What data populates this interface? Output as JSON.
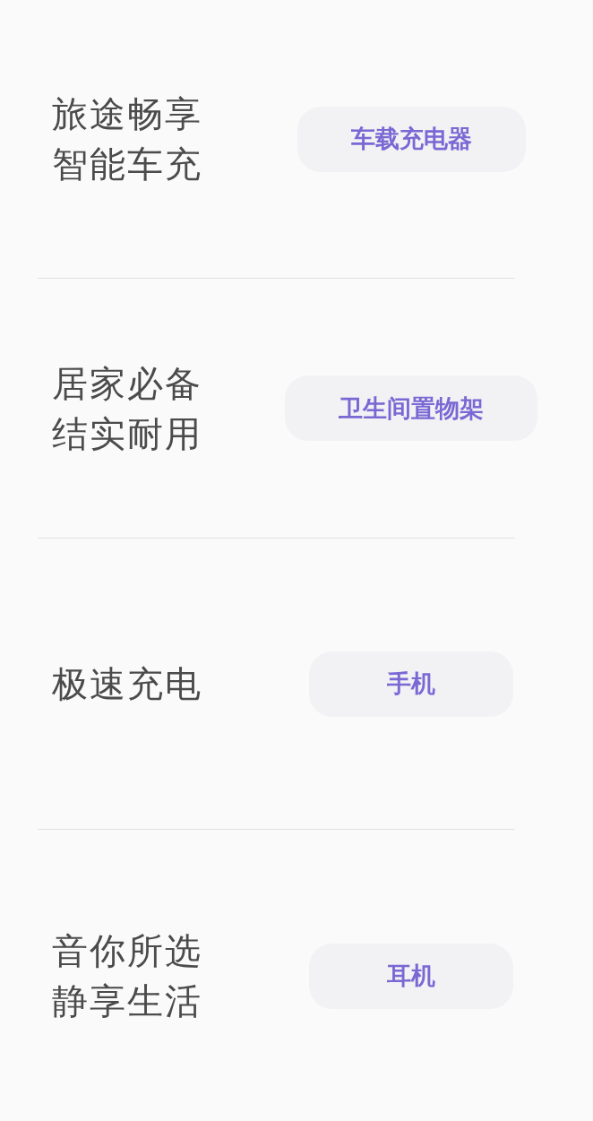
{
  "rows": [
    {
      "slogan": [
        "旅途畅享",
        "智能车充"
      ],
      "button": "车载充电器"
    },
    {
      "slogan": [
        "居家必备",
        "结实耐用"
      ],
      "button": "卫生间置物架"
    },
    {
      "slogan": [
        "极速充电"
      ],
      "button": "手机"
    },
    {
      "slogan": [
        "音你所选",
        "静享生活"
      ],
      "button": "耳机"
    }
  ]
}
